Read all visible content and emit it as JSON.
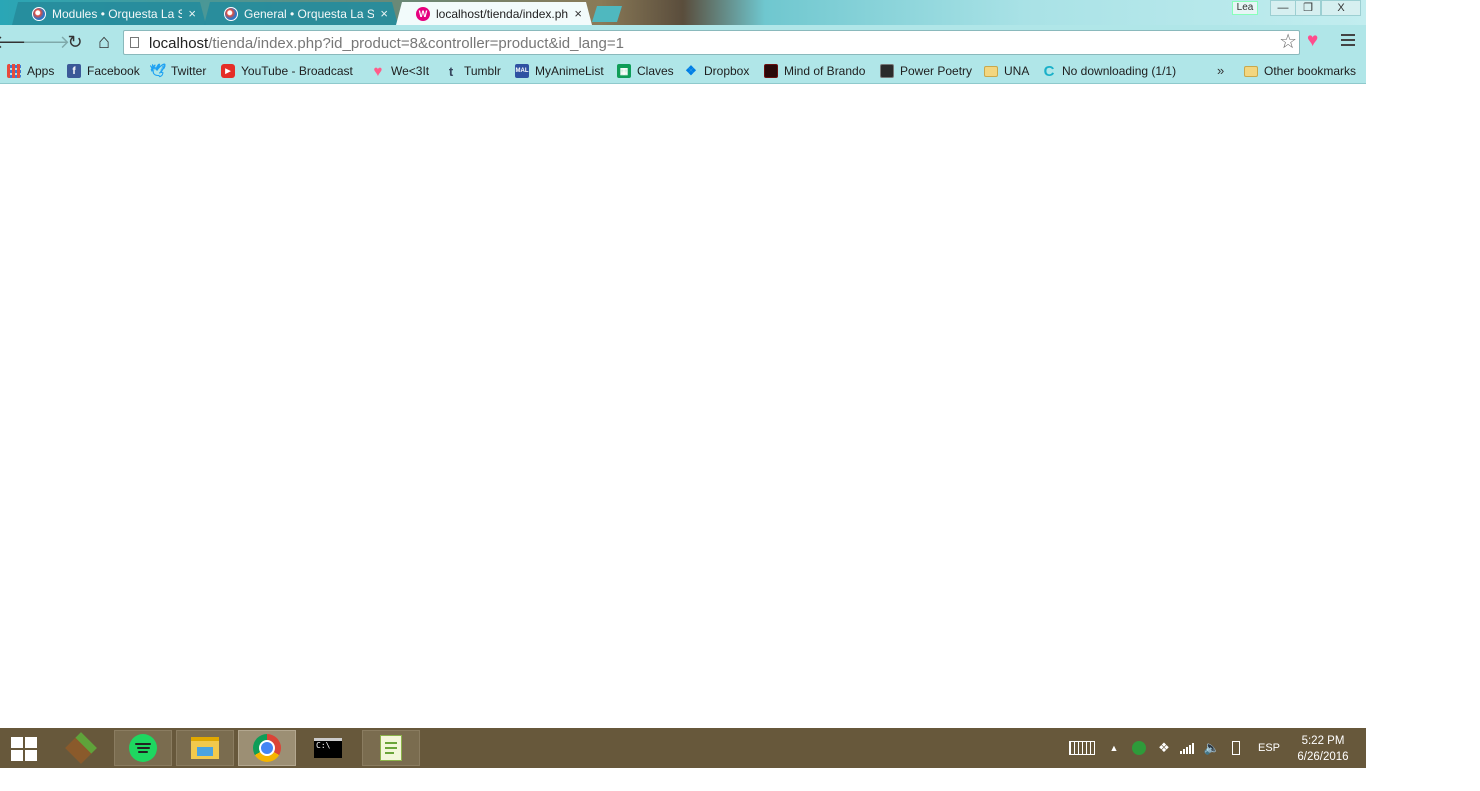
{
  "window": {
    "profile_name": "Lea",
    "controls": {
      "minimize": "—",
      "restore": "❐",
      "close": "X"
    }
  },
  "tabs": [
    {
      "title": "Modules • Orquesta La So",
      "close": "×",
      "active": false
    },
    {
      "title": "General • Orquesta La Sol",
      "close": "×",
      "active": false
    },
    {
      "title": "localhost/tienda/index.php",
      "close": "×",
      "active": true,
      "favicon_letter": "W"
    }
  ],
  "toolbar": {
    "back": "🡐",
    "forward": "🡒",
    "reload": "↻",
    "home": "⌂",
    "url_host": "localhost",
    "url_rest": "/tienda/index.php?id_product=8&controller=product&id_lang=1",
    "bookmark_star": "☆",
    "extension_heart": "♥"
  },
  "bookmarks": {
    "items": [
      {
        "label": "Apps",
        "icon": "apps-grid-icon",
        "color": "#e84a3c"
      },
      {
        "label": "Facebook",
        "icon": "facebook-icon",
        "color": "#3b5998"
      },
      {
        "label": "Twitter",
        "icon": "twitter-icon",
        "color": "#1da1f2"
      },
      {
        "label": "YouTube - Broadcast",
        "icon": "youtube-icon",
        "color": "#e52d27"
      },
      {
        "label": "We<3It",
        "icon": "heart-icon",
        "color": "#ff5c8a"
      },
      {
        "label": "Tumblr",
        "icon": "tumblr-icon",
        "color": "#36465d"
      },
      {
        "label": "MyAnimeList",
        "icon": "myanimelist-icon",
        "color": "#2e51a2"
      },
      {
        "label": "Claves",
        "icon": "sheets-icon",
        "color": "#0f9d58"
      },
      {
        "label": "Dropbox",
        "icon": "dropbox-icon",
        "color": "#007ee5"
      },
      {
        "label": "Mind of Brando",
        "icon": "site-icon",
        "color": "#6b1010"
      },
      {
        "label": "Power Poetry",
        "icon": "site-icon",
        "color": "#2b2b2b"
      },
      {
        "label": "UNA",
        "icon": "folder-icon",
        "color": "#e7c065"
      },
      {
        "label": "No downloading (1/1)",
        "icon": "c-icon",
        "color": "#1ab0c9"
      }
    ],
    "overflow": "»",
    "other_bookmarks": "Other bookmarks"
  },
  "taskbar": {
    "apps": [
      "minecraft-icon",
      "spotify-icon",
      "file-explorer-icon",
      "chrome-icon",
      "command-prompt-icon",
      "notepad-plus-plus-icon"
    ],
    "tray": {
      "language": "ESP",
      "overflow_arrow": "▲"
    },
    "clock": {
      "time": "5:22 PM",
      "date": "6/26/2016"
    }
  }
}
